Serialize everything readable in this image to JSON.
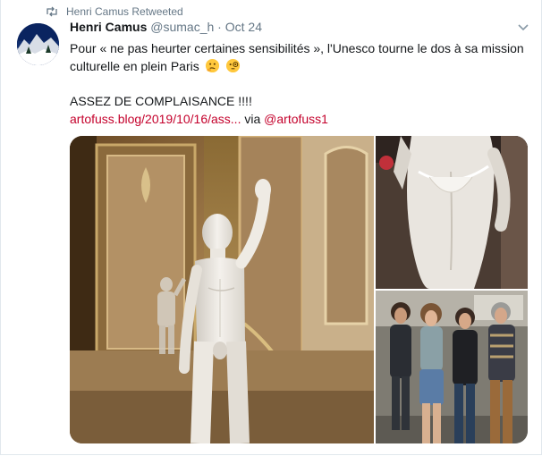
{
  "retweet": {
    "text": "Henri Camus Retweeted",
    "icon": "retweet-icon"
  },
  "author": {
    "name": "Henri Camus",
    "handle": "@sumac_h",
    "separator": "·",
    "date": "Oct 24"
  },
  "tweet": {
    "text": "Pour « ne pas heurter certaines sensibilités », l'Unesco tourne le dos à sa mission culturelle en plein Paris",
    "emojis": [
      "thinking-face-icon",
      "face-with-monocle-icon"
    ],
    "line2": "ASSEZ DE COMPLAISANCE !!!!",
    "link_text": "artofuss.blog/2019/10/16/ass...",
    "via_text": "via",
    "mention": "@artofuss1"
  },
  "media": [
    "statue-photo",
    "statue-back-photo",
    "visitors-group-photo"
  ],
  "colors": {
    "link": "#c4002b",
    "secondary": "#657786",
    "text": "#14171a"
  }
}
